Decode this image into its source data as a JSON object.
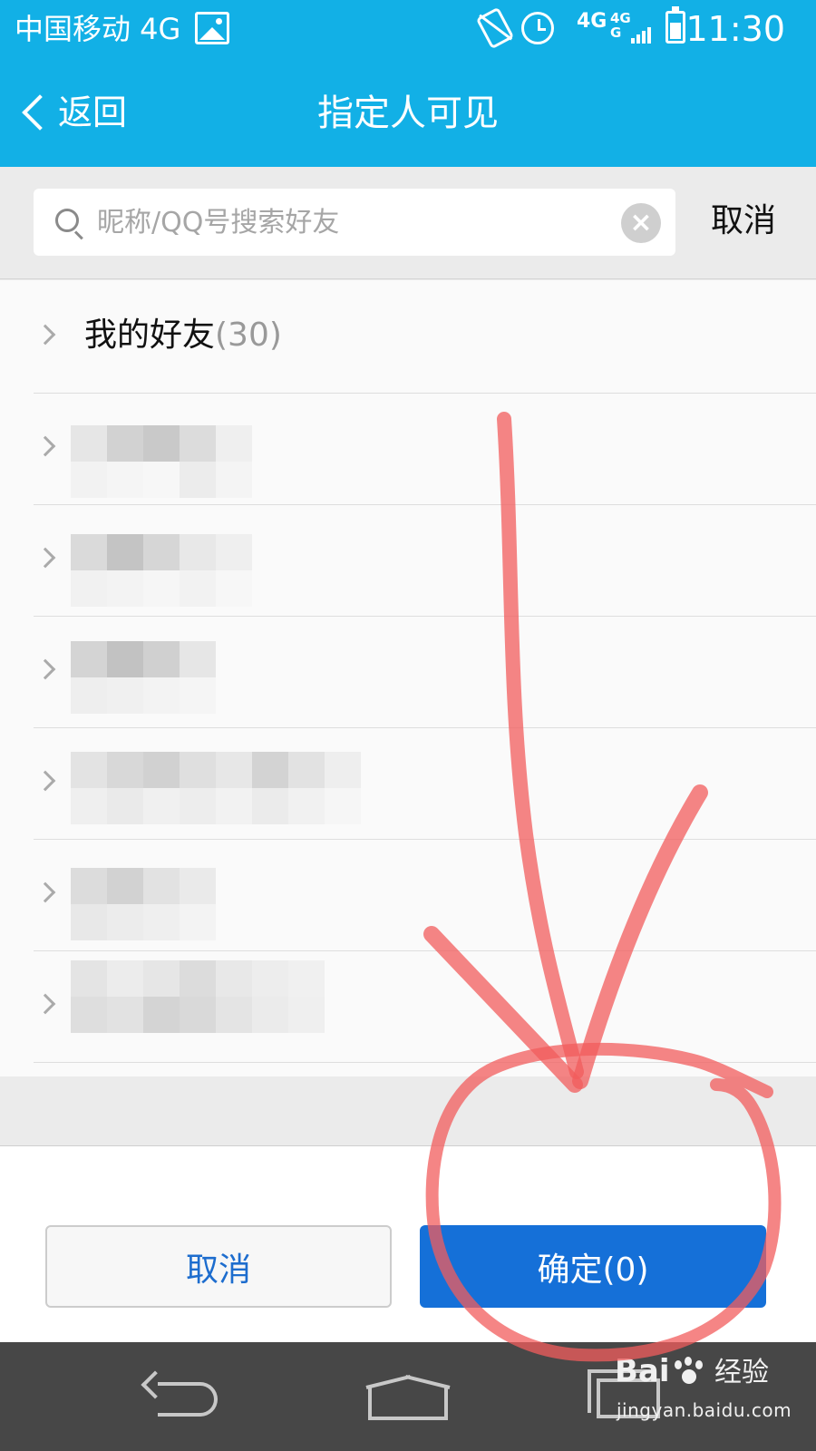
{
  "status_bar": {
    "carrier": "中国移动 4G",
    "network_1": "4G",
    "network_2a": "4G",
    "network_2b": "G",
    "time": "11:30",
    "icons": [
      "image-icon",
      "vibrate-icon",
      "alarm-icon",
      "signal-icon",
      "battery-icon"
    ]
  },
  "title_bar": {
    "back_label": "返回",
    "title": "指定人可见"
  },
  "search": {
    "placeholder": "昵称/QQ号搜索好友",
    "value": "",
    "cancel_label": "取消"
  },
  "groups": [
    {
      "label": "我的好友",
      "count": "(30)",
      "obscured": false
    },
    {
      "label": "",
      "count": "",
      "obscured": true
    },
    {
      "label": "",
      "count": "",
      "obscured": true
    },
    {
      "label": "",
      "count": "",
      "obscured": true
    },
    {
      "label": "",
      "count": "",
      "obscured": true
    },
    {
      "label": "",
      "count": "",
      "obscured": true
    },
    {
      "label": "",
      "count": "",
      "obscured": true
    }
  ],
  "bottom_bar": {
    "cancel_label": "取消",
    "confirm_label": "确定(0)"
  },
  "watermark": {
    "brand": "Bai",
    "text": "经验",
    "url": "jingyan.baidu.com"
  },
  "colors": {
    "header": "#12b0e6",
    "confirm_button": "#1570d8",
    "annotation": "#f07070"
  }
}
